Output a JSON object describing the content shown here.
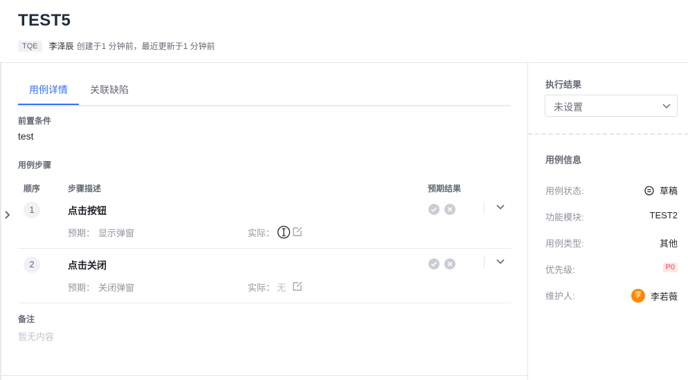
{
  "header": {
    "title": "TEST5",
    "project_badge": "TQE",
    "author": "李泽辰",
    "meta_text": "创建于1 分钟前，最近更新于1 分钟前"
  },
  "tabs": [
    {
      "label": "用例详情",
      "active": true
    },
    {
      "label": "关联缺陷",
      "active": false
    }
  ],
  "precondition": {
    "label": "前置条件",
    "value": "test"
  },
  "steps": {
    "label": "用例步骤",
    "columns": {
      "order": "顺序",
      "description": "步骤描述",
      "expected_result": "预期结果"
    },
    "expected_prefix": "预期：",
    "actual_prefix": "实际：",
    "rows": [
      {
        "num": "1",
        "title": "点击按钮",
        "expected": "显示弹窗",
        "actual": ""
      },
      {
        "num": "2",
        "title": "点击关闭",
        "expected": "关闭弹窗",
        "actual": "无"
      }
    ]
  },
  "remark": {
    "label": "备注",
    "value": "暂无内容"
  },
  "execution": {
    "label": "执行结果",
    "selected": "未设置"
  },
  "case_info": {
    "label": "用例信息",
    "rows": {
      "status": {
        "key": "用例状态:",
        "value": "草稿"
      },
      "module": {
        "key": "功能模块:",
        "value": "TEST2"
      },
      "type": {
        "key": "用例类型:",
        "value": "其他"
      },
      "priority": {
        "key": "优先级:",
        "value": "P0"
      },
      "owner": {
        "key": "维护人:",
        "value": "李若薇",
        "avatar": "李"
      }
    }
  },
  "colors": {
    "accent": "#3370ff",
    "priority_bg": "#fde7e7",
    "priority_text": "#f54a45",
    "avatar": "#ff8800"
  },
  "icons": [
    "check-circle-icon",
    "close-circle-icon",
    "chevron-down-icon",
    "edit-icon",
    "expand-arrow-icon",
    "text-cursor-icon",
    "draft-status-icon"
  ]
}
